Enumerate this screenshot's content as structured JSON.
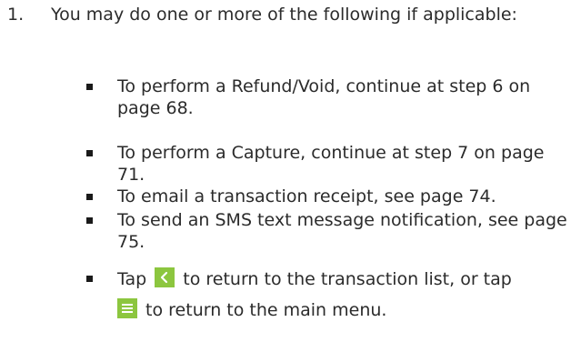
{
  "step": {
    "number": "1.",
    "intro": "You may do one or more of the following if applicable:"
  },
  "bullets": [
    {
      "text": "To perform a Refund/Void, continue at step 6 on page 68."
    },
    {
      "text": "To perform a Capture, continue at step 7 on page 71."
    },
    {
      "text": "To email a transaction receipt, see page 74."
    },
    {
      "text": "To send an SMS text message notification, see page 75."
    }
  ],
  "last_bullet": {
    "tap_label": "Tap",
    "back_text": "to return to the transaction list, or tap",
    "menu_text": "to return to the main menu."
  },
  "icons": {
    "back": "chevron-left-icon",
    "menu": "hamburger-menu-icon",
    "icon_background": "#8cc63f",
    "icon_glyph": "#ffffff"
  }
}
